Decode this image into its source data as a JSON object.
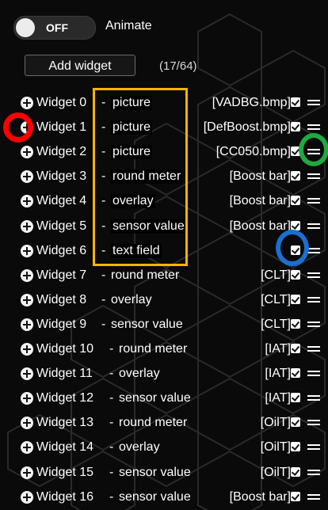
{
  "controls": {
    "toggle_state": "OFF",
    "animate_label": "Animate",
    "add_widget_label": "Add widget",
    "count": "(17/64)"
  },
  "widgets": [
    {
      "name": "Widget 0",
      "type": "picture",
      "param": "[VADBG.bmp]"
    },
    {
      "name": "Widget 1",
      "type": "picture",
      "param": "[DefBoost.bmp]"
    },
    {
      "name": "Widget 2",
      "type": "picture",
      "param": "[CC050.bmp]"
    },
    {
      "name": "Widget 3",
      "type": "round meter",
      "param": "[Boost bar]"
    },
    {
      "name": "Widget 4",
      "type": "overlay",
      "param": "[Boost bar]"
    },
    {
      "name": "Widget 5",
      "type": "sensor value",
      "param": "[Boost bar]"
    },
    {
      "name": "Widget 6",
      "type": "text field",
      "param": ""
    },
    {
      "name": "Widget 7",
      "type": "round meter",
      "param": "[CLT]"
    },
    {
      "name": "Widget 8",
      "type": "overlay",
      "param": "[CLT]"
    },
    {
      "name": "Widget 9",
      "type": "sensor value",
      "param": "[CLT]"
    },
    {
      "name": "Widget 10",
      "type": "round meter",
      "param": "[IAT]"
    },
    {
      "name": "Widget 11",
      "type": "overlay",
      "param": "[IAT]"
    },
    {
      "name": "Widget 12",
      "type": "sensor value",
      "param": "[IAT]"
    },
    {
      "name": "Widget 13",
      "type": "round meter",
      "param": "[OilT]"
    },
    {
      "name": "Widget 14",
      "type": "overlay",
      "param": "[OilT]"
    },
    {
      "name": "Widget 15",
      "type": "sensor value",
      "param": "[OilT]"
    },
    {
      "name": "Widget 16",
      "type": "sensor value",
      "param": "[Boost bar]"
    }
  ],
  "colors": {
    "background": "#0a0a0a",
    "highlight_box": "#f7b500",
    "ring_red": "#ff0000",
    "ring_green": "#1faa3f",
    "ring_blue": "#1a6fd0"
  },
  "icons": {
    "add": "plus-circle-icon",
    "enabled": "checkbox-checked-icon",
    "reorder": "drag-handle-icon"
  }
}
